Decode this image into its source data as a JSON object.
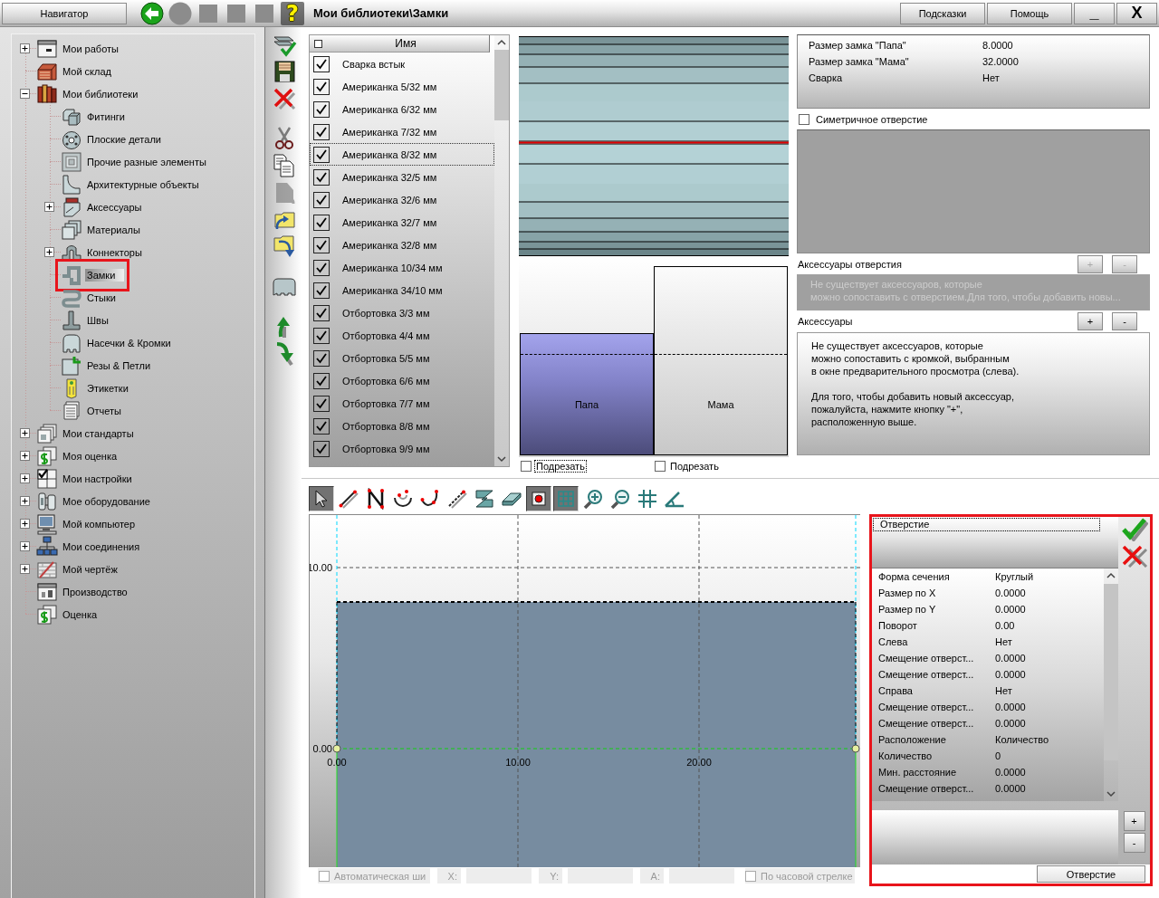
{
  "topbar": {
    "navigator_button": "Навигатор",
    "nav_icons": [
      {
        "kind": "back",
        "disabled": false
      },
      {
        "kind": "round",
        "disabled": true
      },
      {
        "kind": "square",
        "disabled": true
      },
      {
        "kind": "square",
        "disabled": true
      },
      {
        "kind": "square",
        "disabled": true
      }
    ],
    "help": "?",
    "title": "Мои библиотеки\\Замки",
    "buttons": [
      "Подсказки",
      "Помощь"
    ],
    "minimize": "_",
    "close": "X"
  },
  "navigator": {
    "items": [
      {
        "label": "Мои работы",
        "kind": "window",
        "expanded": false,
        "selected": false,
        "highlighted": false
      },
      {
        "label": "Мой склад",
        "kind": "warehouse",
        "selected": false,
        "highlighted": false
      },
      {
        "label": "Мои библиотеки",
        "kind": "books",
        "expanded": true,
        "selected": false,
        "highlighted": false,
        "children": [
          {
            "label": "Фитинги",
            "kind": "cubes",
            "selected": false,
            "highlighted": false
          },
          {
            "label": "Плоские детали",
            "kind": "disc",
            "selected": false,
            "highlighted": false
          },
          {
            "label": "Прочие разные элементы",
            "kind": "frame",
            "selected": false,
            "highlighted": false
          },
          {
            "label": "Архитектурные объекты",
            "kind": "profile",
            "selected": false,
            "highlighted": false
          },
          {
            "label": "Аксессуары",
            "kind": "accessory",
            "expanded": false,
            "selected": false,
            "highlighted": false
          },
          {
            "label": "Материалы",
            "kind": "sheets",
            "selected": false,
            "highlighted": false
          },
          {
            "label": "Коннекторы",
            "kind": "connector",
            "expanded": false,
            "selected": false,
            "highlighted": false
          },
          {
            "label": "Замки",
            "kind": "lock",
            "selected": true,
            "highlighted": true
          },
          {
            "label": "Стыки",
            "kind": "joint",
            "selected": false,
            "highlighted": false
          },
          {
            "label": "Швы",
            "kind": "seam",
            "selected": false,
            "highlighted": false
          },
          {
            "label": "Насечки & Кромки",
            "kind": "notch",
            "selected": false,
            "highlighted": false
          },
          {
            "label": "Резы & Петли",
            "kind": "cut",
            "selected": false,
            "highlighted": false
          },
          {
            "label": "Этикетки",
            "kind": "tag",
            "selected": false,
            "highlighted": false
          },
          {
            "label": "Отчеты",
            "kind": "report",
            "selected": false,
            "highlighted": false
          }
        ]
      },
      {
        "label": "Мои стандарты",
        "kind": "standards",
        "expanded": false,
        "selected": false,
        "highlighted": false
      },
      {
        "label": "Моя оценка",
        "kind": "estimate",
        "expanded": false,
        "selected": false,
        "highlighted": false
      },
      {
        "label": "Мои настройки",
        "kind": "settings",
        "expanded": false,
        "selected": false,
        "highlighted": false
      },
      {
        "label": "Мое оборудование",
        "kind": "equipment",
        "expanded": false,
        "selected": false,
        "highlighted": false
      },
      {
        "label": "Мой компьютер",
        "kind": "computer",
        "expanded": false,
        "selected": false,
        "highlighted": false
      },
      {
        "label": "Мои соединения",
        "kind": "network",
        "expanded": false,
        "selected": false,
        "highlighted": false
      },
      {
        "label": "Мой чертёж",
        "kind": "drawing",
        "expanded": false,
        "selected": false,
        "highlighted": false
      },
      {
        "label": "Производство",
        "kind": "production",
        "selected": false,
        "highlighted": false
      },
      {
        "label": "Оценка",
        "kind": "estimate",
        "selected": false,
        "highlighted": false
      }
    ]
  },
  "side_toolbar": {
    "groups": [
      [
        {
          "kind": "apply",
          "disabled": false
        },
        {
          "kind": "save",
          "disabled": false
        },
        {
          "kind": "delete",
          "disabled": false
        }
      ],
      [
        {
          "kind": "cut",
          "disabled": false
        },
        {
          "kind": "copy",
          "disabled": false
        },
        {
          "kind": "paste",
          "disabled": true
        },
        {
          "kind": "import",
          "disabled": false
        },
        {
          "kind": "export",
          "disabled": false
        }
      ],
      [
        {
          "kind": "profile",
          "disabled": false
        }
      ],
      [
        {
          "kind": "move_up",
          "disabled": false
        },
        {
          "kind": "move_down",
          "disabled": false
        }
      ]
    ]
  },
  "lock_list": {
    "header": "Имя",
    "header_checked": false,
    "rows": [
      {
        "name": "Сварка встык",
        "checked": true,
        "selected": false
      },
      {
        "name": "Американка 5/32 мм",
        "checked": true,
        "selected": false
      },
      {
        "name": "Американка 6/32 мм",
        "checked": true,
        "selected": false
      },
      {
        "name": "Американка 7/32 мм",
        "checked": true,
        "selected": false
      },
      {
        "name": "Американка 8/32 мм",
        "checked": true,
        "selected": true
      },
      {
        "name": "Американка 32/5 мм",
        "checked": true,
        "selected": false
      },
      {
        "name": "Американка 32/6 мм",
        "checked": true,
        "selected": false
      },
      {
        "name": "Американка 32/7 мм",
        "checked": true,
        "selected": false
      },
      {
        "name": "Американка 32/8 мм",
        "checked": true,
        "selected": false
      },
      {
        "name": "Американка 10/34 мм",
        "checked": true,
        "selected": false
      },
      {
        "name": "Американка 34/10 мм",
        "checked": true,
        "selected": false
      },
      {
        "name": "Отбортовка 3/3 мм",
        "checked": true,
        "selected": false
      },
      {
        "name": "Отбортовка 4/4 мм",
        "checked": true,
        "selected": false
      },
      {
        "name": "Отбортовка 5/5 мм",
        "checked": true,
        "selected": false
      },
      {
        "name": "Отбортовка 6/6 мм",
        "checked": true,
        "selected": false
      },
      {
        "name": "Отбортовка 7/7 мм",
        "checked": true,
        "selected": false
      },
      {
        "name": "Отбортовка 8/8 мм",
        "checked": true,
        "selected": false
      },
      {
        "name": "Отбортовка 9/9 мм",
        "checked": true,
        "selected": false
      }
    ]
  },
  "preview": {
    "parts": [
      {
        "label": "Папа",
        "selected": true,
        "trim": {
          "label": "Подрезать",
          "checked": false,
          "focused": true
        }
      },
      {
        "label": "Мама",
        "selected": false,
        "trim": {
          "label": "Подрезать",
          "checked": false,
          "focused": false
        }
      }
    ]
  },
  "right_panel": {
    "lock_properties": [
      {
        "name": "Размер замка \"Папа\"",
        "value": "8.0000"
      },
      {
        "name": "Размер замка \"Мама\"",
        "value": "32.0000"
      },
      {
        "name": "Сварка",
        "value": "Нет"
      }
    ],
    "symmetric_hole": {
      "label": "Симетричное отверстие",
      "checked": false
    },
    "hole_accessories": {
      "title": "Аксессуары отверстия",
      "add": "+",
      "remove": "-",
      "disabled": true,
      "message": "Не существует аксессуаров, которые\nможно сопоставить с отверстием.Для того, чтобы добавить новы..."
    },
    "accessories": {
      "title": "Аксессуары",
      "add": "+",
      "remove": "-",
      "disabled": false,
      "message": "Не существует аксессуаров, которые\nможно сопоставить с кромкой, выбранным\nв окне предварительного просмотра (слева).\n\nДля того, чтобы добавить новый аксессуар,\nпожалуйста, нажмите кнопку \"+\",\nрасположенную выше."
    }
  },
  "drawing_toolbar": {
    "tools": [
      {
        "kind": "select",
        "on": true
      },
      {
        "kind": "line",
        "on": false
      },
      {
        "kind": "polyline",
        "on": false
      },
      {
        "kind": "arc",
        "on": false
      },
      {
        "kind": "curve",
        "on": false
      },
      {
        "kind": "pen",
        "on": false
      },
      {
        "kind": "zigzag",
        "on": false
      },
      {
        "kind": "eraser",
        "on": false
      },
      {
        "kind": "snap",
        "on": true
      },
      {
        "kind": "grid",
        "on": true
      },
      {
        "kind": "zoom_in",
        "on": false
      },
      {
        "kind": "zoom_out",
        "on": false
      },
      {
        "kind": "hash",
        "on": false
      },
      {
        "kind": "angle",
        "on": false
      }
    ]
  },
  "canvas": {
    "y_ticks": [
      "10.00",
      "0.00"
    ],
    "x_ticks": [
      "0.00",
      "10.00",
      "20.00"
    ]
  },
  "status": {
    "auto_width": {
      "label": "Автоматическая ши",
      "checked": false,
      "disabled": true
    },
    "coords": [
      {
        "label": "X:",
        "disabled": true
      },
      {
        "label": "Y:",
        "disabled": true
      },
      {
        "label": "A:",
        "disabled": true
      }
    ],
    "clockwise": {
      "label": "По часовой стрелке",
      "checked": false,
      "disabled": true
    }
  },
  "hole_panel": {
    "highlighted": true,
    "title": "Отверстие",
    "properties": [
      {
        "name": "Форма сечения",
        "value": "Круглый"
      },
      {
        "name": "Размер по X",
        "value": "0.0000"
      },
      {
        "name": "Размер по Y",
        "value": "0.0000"
      },
      {
        "name": "Поворот",
        "value": "0.00"
      },
      {
        "name": "Слева",
        "value": "Нет"
      },
      {
        "name": "Смещение отверст...",
        "value": "0.0000"
      },
      {
        "name": "Смещение отверст...",
        "value": "0.0000"
      },
      {
        "name": "Справа",
        "value": "Нет"
      },
      {
        "name": "Смещение отверст...",
        "value": "0.0000"
      },
      {
        "name": "Смещение отверст...",
        "value": "0.0000"
      },
      {
        "name": "Расположение",
        "value": "Количество"
      },
      {
        "name": "Количество",
        "value": "0"
      },
      {
        "name": "Мин. расстояние",
        "value": "0.0000"
      },
      {
        "name": "Смещение отверст...",
        "value": "0.0000"
      }
    ],
    "add": "+",
    "remove": "-",
    "button": "Отверстие"
  }
}
